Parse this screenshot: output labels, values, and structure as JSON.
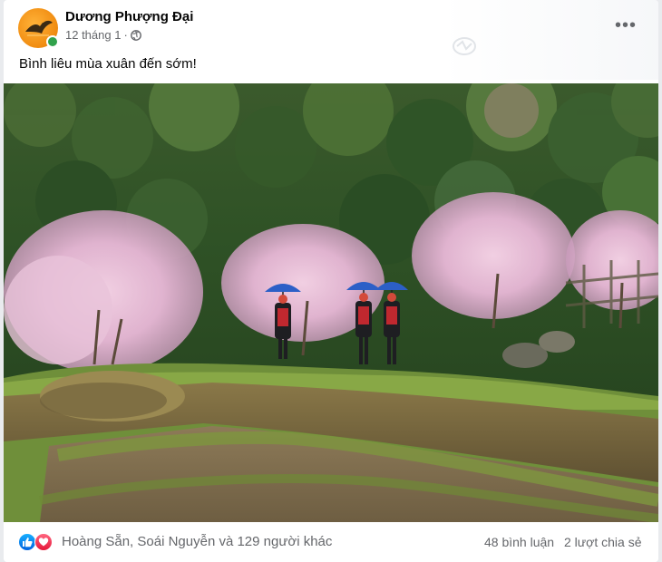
{
  "post": {
    "author": "Dương Phượng Đại",
    "date": "12 tháng 1",
    "separator": "·",
    "privacy_icon": "globe-icon",
    "text": "Bình liêu mùa xuân đến sớm!",
    "more_icon": "more-horizontal-icon",
    "more_label": "•••"
  },
  "photo": {
    "description_icon": "landscape-photo"
  },
  "footer": {
    "reaction_icons": [
      "like-icon",
      "love-icon"
    ],
    "reactors": "Hoàng Sẵn, Soái Nguyễn và 129 người khác",
    "comments": "48 bình luận",
    "shares": "2 lượt chia sẻ"
  },
  "colors": {
    "link_blue": "#1877f2",
    "secondary_text": "#65676b",
    "online_green": "#31a24c"
  }
}
